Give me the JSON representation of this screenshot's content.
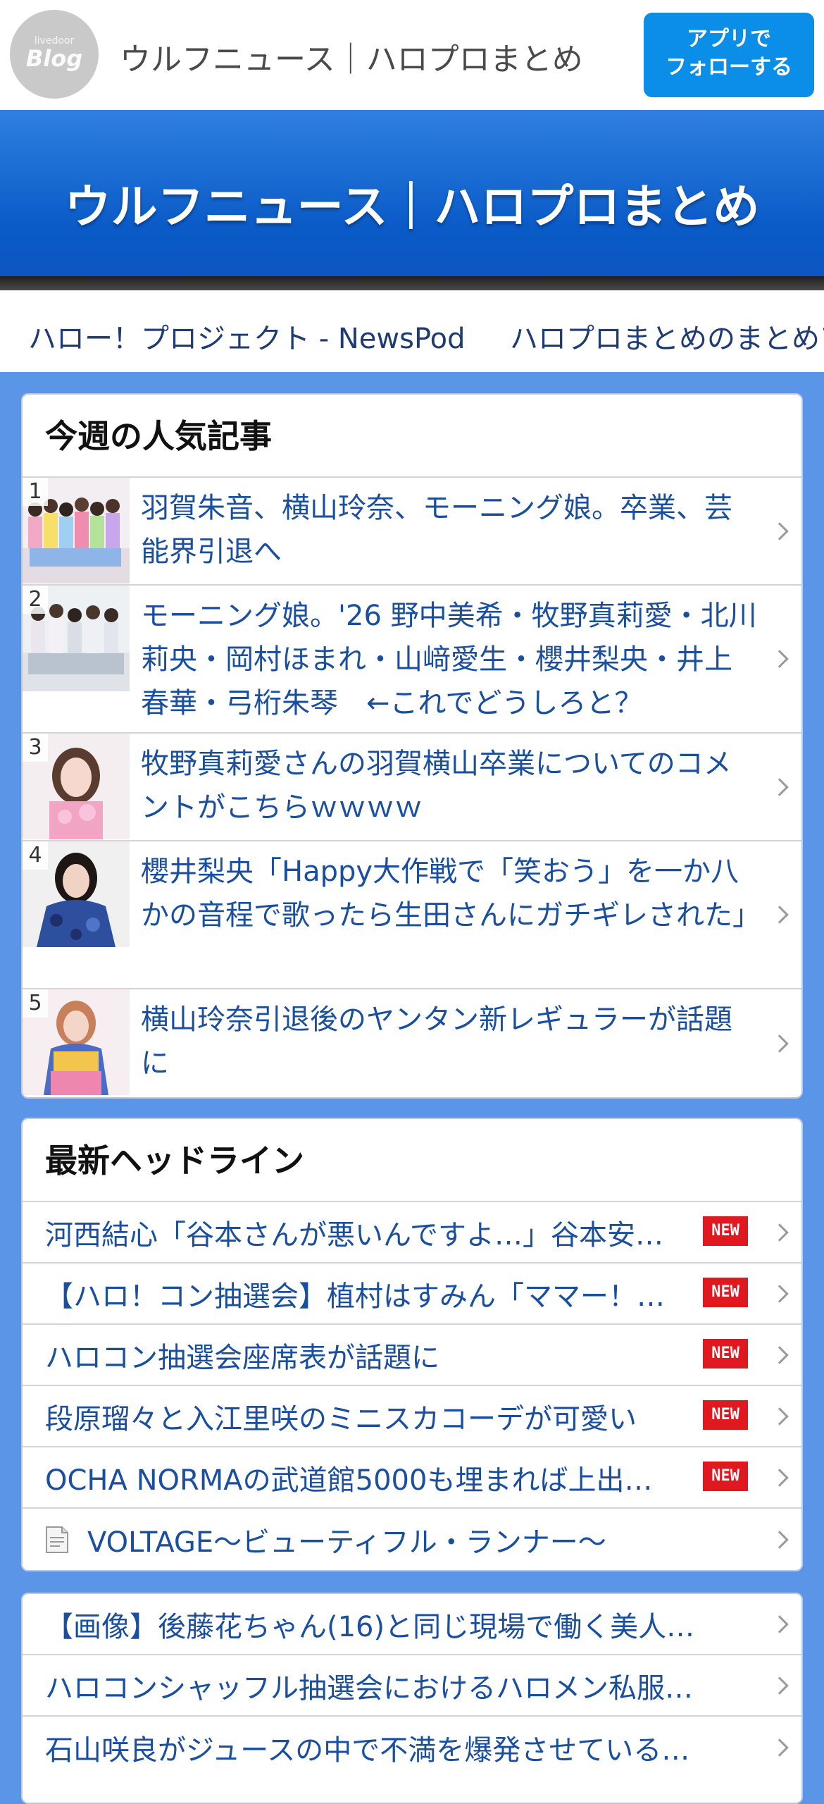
{
  "top_bar": {
    "logo_small": "livedoor",
    "logo_big": "Blog",
    "title": "ウルフニュース｜ハロプロまとめ",
    "follow_line1": "アプリで",
    "follow_line2": "フォローする"
  },
  "header": {
    "title": "ウルフニュース｜ハロプロまとめ"
  },
  "strip": {
    "links": [
      "ハロー！プロジェクト - NewsPod",
      "ハロプロまとめのまとめア"
    ]
  },
  "popular": {
    "heading": "今週の人気記事",
    "items": [
      {
        "rank": "1",
        "title": "羽賀朱音、横山玲奈、モーニング娘。卒業、芸能界引退へ"
      },
      {
        "rank": "2",
        "title": "モーニング娘。'26 野中美希・牧野真莉愛・北川莉央・岡村ほまれ・山﨑愛生・櫻井梨央・井上春華・弓桁朱琴　←これでどうしろと？"
      },
      {
        "rank": "3",
        "title": "牧野真莉愛さんの羽賀横山卒業についてのコメントがこちらｗｗｗｗ"
      },
      {
        "rank": "4",
        "title": "櫻井梨央「Happy大作戦で「笑おう」を一か八かの音程で歌ったら生田さんにガチギレされた」"
      },
      {
        "rank": "5",
        "title": "横山玲奈引退後のヤンタン新レギュラーが話題に"
      }
    ]
  },
  "headlines": {
    "heading": "最新ヘッドライン",
    "badge_label": "NEW",
    "items": [
      {
        "title": "河西結心「谷本さんが悪いんですよ…」谷本安…",
        "new": true
      },
      {
        "title": "【ハロ！コン抽選会】植村はすみん「ママー！…",
        "new": true
      },
      {
        "title": "ハロコン抽選会座席表が話題に",
        "new": true
      },
      {
        "title": "段原瑠々と入江里咲のミニスカコーデが可愛い",
        "new": true
      },
      {
        "title": "OCHA NORMAの武道館5000も埋まれば上出…",
        "new": true
      },
      {
        "title": "VOLTAGE～ビューティフル・ランナー～",
        "new": false,
        "icon": "document-icon"
      }
    ]
  },
  "more": {
    "items": [
      "【画像】後藤花ちゃん(16)と同じ現場で働く美人…",
      "ハロコンシャッフル抽選会におけるハロメン私服…",
      "石山咲良がジュースの中で不満を爆発させている…"
    ]
  }
}
